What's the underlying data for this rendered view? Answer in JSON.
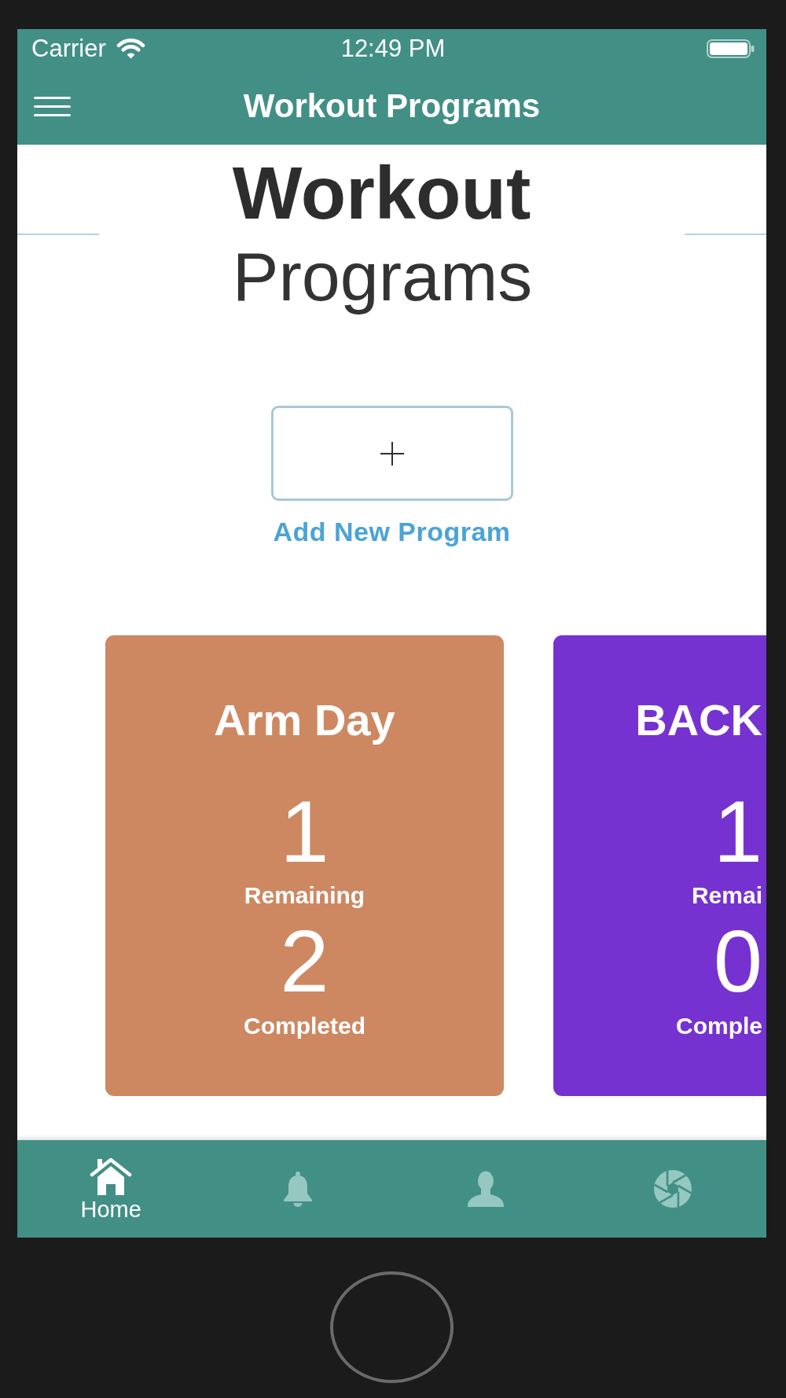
{
  "status_bar": {
    "carrier": "Carrier",
    "time": "12:49 PM"
  },
  "nav_bar": {
    "title": "Workout Programs"
  },
  "heading": {
    "bold_line": "Workout",
    "light_line": "Programs"
  },
  "add_program": {
    "label": "Add New Program"
  },
  "cards": [
    {
      "title": "Arm Day",
      "remaining": "1",
      "remaining_label": "Remaining",
      "completed": "2",
      "completed_label": "Completed",
      "color": "#cd8862",
      "clipped": false
    },
    {
      "title": "BACK",
      "remaining": "1",
      "remaining_label": "Remai",
      "completed": "0",
      "completed_label": "Comple",
      "color": "#7632d0",
      "clipped": true
    }
  ],
  "tab_bar": {
    "tabs": [
      {
        "label": "Home",
        "selected": true
      },
      {
        "selected": false
      },
      {
        "selected": false
      },
      {
        "selected": false
      }
    ]
  }
}
